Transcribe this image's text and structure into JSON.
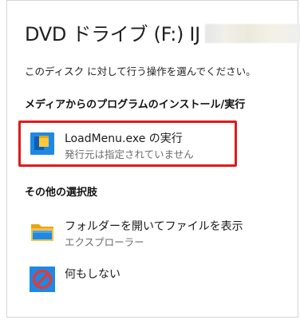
{
  "header": {
    "title": "DVD ドライブ (F:) IJ"
  },
  "prompt": "このディスク に対して行う操作を選んでください。",
  "sections": {
    "install_heading": "メディアからのプログラムのインストール/実行",
    "other_heading": "その他の選択肢"
  },
  "options": {
    "run": {
      "label": "LoadMenu.exe の実行",
      "sub": "発行元は指定されていません",
      "icon": "app-window-icon"
    },
    "folder": {
      "label": "フォルダーを開いてファイルを表示",
      "sub": "エクスプローラー",
      "icon": "folder-icon"
    },
    "none": {
      "label": "何もしない",
      "icon": "no-action-icon"
    }
  },
  "colors": {
    "highlight_border": "#e01919",
    "blue": "#1e88e5",
    "folder_yellow": "#f7c23b",
    "no_red": "#e53935"
  }
}
